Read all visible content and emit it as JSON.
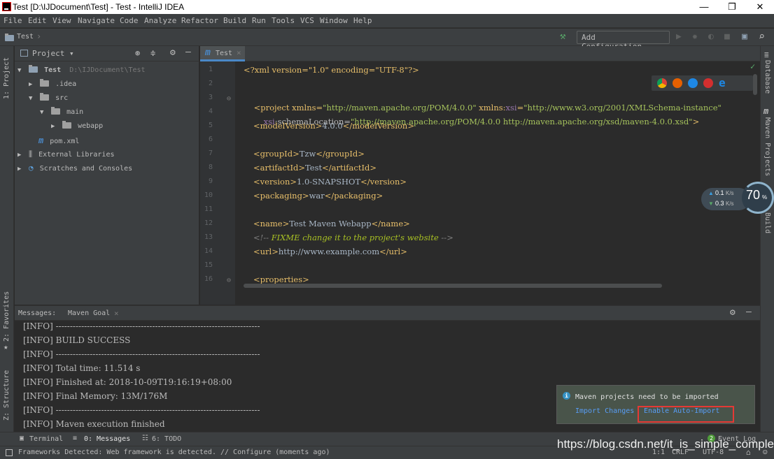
{
  "window": {
    "title": "Test [D:\\IJDocument\\Test] - Test - IntelliJ IDEA",
    "minimize": "—",
    "maximize": "❐",
    "close": "✕"
  },
  "menu": [
    "File",
    "Edit",
    "View",
    "Navigate",
    "Code",
    "Analyze",
    "Refactor",
    "Build",
    "Run",
    "Tools",
    "VCS",
    "Window",
    "Help"
  ],
  "navbar": {
    "breadcrumb": "Test",
    "add_configuration": "Add Configuration..."
  },
  "left_strip": {
    "project": "1: Project",
    "favorites": "2: Favorites",
    "structure": "Z: Structure"
  },
  "right_strip": {
    "database": "Database",
    "maven": "Maven Projects",
    "build": "Build"
  },
  "project_panel": {
    "title": "Project ▾",
    "tree": [
      {
        "label": "Test",
        "path": "D:\\IJDocument\\Test",
        "arrow": "▼"
      },
      {
        "label": ".idea",
        "arrow": "▶"
      },
      {
        "label": "src",
        "arrow": "▼"
      },
      {
        "label": "main",
        "arrow": "▼"
      },
      {
        "label": "webapp",
        "arrow": "▶"
      },
      {
        "label": "pom.xml",
        "arrow": ""
      },
      {
        "label": "External Libraries",
        "arrow": "▶"
      },
      {
        "label": "Scratches and Consoles",
        "arrow": "▶"
      }
    ]
  },
  "editor": {
    "tab_label": "Test",
    "tab_close": "×",
    "line_numbers": [
      "1",
      "2",
      "3",
      "4",
      "5",
      "6",
      "7",
      "8",
      "9",
      "10",
      "11",
      "12",
      "13",
      "14",
      "15",
      "16"
    ],
    "code": {
      "l1": "<?xml version=\"1.0\" encoding=\"UTF-8\"?>",
      "l3a": "<project xmlns=",
      "l3b": "\"http://maven.apache.org/POM/4.0.0\"",
      "l3c": " xmlns:",
      "l3d": "xsi",
      "l3e": "=",
      "l3f": "\"http://www.w3.org/2001/XMLSchema-instance\"",
      "l4a": "xsi",
      "l4b": ":schemaLocation=",
      "l4c": "\"http://maven.apache.org/POM/4.0.0 http://maven.apache.org/xsd/maven-4.0.0.xsd\"",
      "l4d": ">",
      "l5": [
        "<modelVersion>",
        "4.0.0",
        "</modelVersion>"
      ],
      "l7": [
        "<groupId>",
        "Tzw",
        "</groupId>"
      ],
      "l8": [
        "<artifactId>",
        "Test",
        "</artifactId>"
      ],
      "l9": [
        "<version>",
        "1.0-SNAPSHOT",
        "</version>"
      ],
      "l10": [
        "<packaging>",
        "war",
        "</packaging>"
      ],
      "l12": [
        "<name>",
        "Test Maven Webapp",
        "</name>"
      ],
      "l13": [
        "<!-- ",
        "FIXME change it to the project's website",
        " -->"
      ],
      "l14": [
        "<url>",
        "http://www.example.com",
        "</url>"
      ],
      "l16": "<properties>"
    }
  },
  "speed_widget": {
    "up": "0.1",
    "down": "0.3",
    "unit": "K/s",
    "percent": "70",
    "percent_sign": "%"
  },
  "messages": {
    "header": "Messages:",
    "tab": "Maven Goal",
    "tab_close": "×",
    "lines": [
      "[INFO] ------------------------------------------------------------------------",
      "[INFO] BUILD SUCCESS",
      "[INFO] ------------------------------------------------------------------------",
      "[INFO] Total time: 11.514 s",
      "[INFO] Finished at: 2018-10-09T19:16:19+08:00",
      "[INFO] Final Memory: 13M/176M",
      "[INFO] ------------------------------------------------------------------------",
      "[INFO] Maven execution finished"
    ]
  },
  "notification": {
    "text": "Maven projects need to be imported",
    "import_changes": "Import Changes",
    "enable_auto_import": "Enable Auto-Import"
  },
  "toolwindows": {
    "terminal": "Terminal",
    "messages": "0: Messages",
    "todo": "6: TODO",
    "event_log": "Event Log",
    "event_count": "2"
  },
  "status": {
    "text": "Frameworks Detected: Web framework is detected. // Configure (moments ago)",
    "position": "1:1",
    "line_sep": "CRLF",
    "encoding": "UTF-8"
  },
  "watermark": "https://blog.csdn.net/it_is_simple_complex"
}
